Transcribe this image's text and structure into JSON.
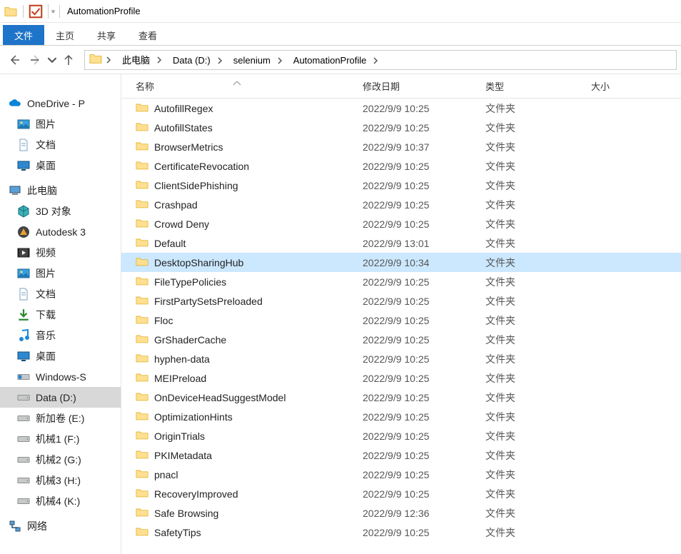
{
  "window": {
    "title": "AutomationProfile"
  },
  "ribbon": {
    "file": "文件",
    "tabs": [
      "主页",
      "共享",
      "查看"
    ]
  },
  "breadcrumb": {
    "items": [
      "此电脑",
      "Data (D:)",
      "selenium",
      "AutomationProfile"
    ]
  },
  "tree": {
    "groups": [
      {
        "root": {
          "label": "OneDrive - P",
          "icon": "onedrive"
        },
        "children": [
          {
            "label": "图片",
            "icon": "pictures"
          },
          {
            "label": "文档",
            "icon": "documents"
          },
          {
            "label": "桌面",
            "icon": "desktop"
          }
        ]
      },
      {
        "root": {
          "label": "此电脑",
          "icon": "thispc"
        },
        "children": [
          {
            "label": "3D 对象",
            "icon": "3d"
          },
          {
            "label": "Autodesk 3",
            "icon": "autodesk"
          },
          {
            "label": "视频",
            "icon": "videos"
          },
          {
            "label": "图片",
            "icon": "pictures"
          },
          {
            "label": "文档",
            "icon": "documents"
          },
          {
            "label": "下载",
            "icon": "downloads"
          },
          {
            "label": "音乐",
            "icon": "music"
          },
          {
            "label": "桌面",
            "icon": "desktop"
          },
          {
            "label": "Windows-S",
            "icon": "drive-os"
          },
          {
            "label": "Data (D:)",
            "icon": "drive",
            "selected": true
          },
          {
            "label": "新加卷 (E:)",
            "icon": "drive"
          },
          {
            "label": "机械1 (F:)",
            "icon": "drive"
          },
          {
            "label": "机械2 (G:)",
            "icon": "drive"
          },
          {
            "label": "机械3 (H:)",
            "icon": "drive"
          },
          {
            "label": "机械4 (K:)",
            "icon": "drive"
          }
        ]
      },
      {
        "root": {
          "label": "网络",
          "icon": "network"
        },
        "children": []
      }
    ]
  },
  "columns": {
    "name": "名称",
    "date": "修改日期",
    "type": "类型",
    "size": "大小"
  },
  "type_label": "文件夹",
  "rows": [
    {
      "name": "AutofillRegex",
      "date": "2022/9/9 10:25"
    },
    {
      "name": "AutofillStates",
      "date": "2022/9/9 10:25"
    },
    {
      "name": "BrowserMetrics",
      "date": "2022/9/9 10:37"
    },
    {
      "name": "CertificateRevocation",
      "date": "2022/9/9 10:25"
    },
    {
      "name": "ClientSidePhishing",
      "date": "2022/9/9 10:25"
    },
    {
      "name": "Crashpad",
      "date": "2022/9/9 10:25"
    },
    {
      "name": "Crowd Deny",
      "date": "2022/9/9 10:25"
    },
    {
      "name": "Default",
      "date": "2022/9/9 13:01"
    },
    {
      "name": "DesktopSharingHub",
      "date": "2022/9/9 10:34",
      "selected": true
    },
    {
      "name": "FileTypePolicies",
      "date": "2022/9/9 10:25"
    },
    {
      "name": "FirstPartySetsPreloaded",
      "date": "2022/9/9 10:25"
    },
    {
      "name": "Floc",
      "date": "2022/9/9 10:25"
    },
    {
      "name": "GrShaderCache",
      "date": "2022/9/9 10:25"
    },
    {
      "name": "hyphen-data",
      "date": "2022/9/9 10:25"
    },
    {
      "name": "MEIPreload",
      "date": "2022/9/9 10:25"
    },
    {
      "name": "OnDeviceHeadSuggestModel",
      "date": "2022/9/9 10:25"
    },
    {
      "name": "OptimizationHints",
      "date": "2022/9/9 10:25"
    },
    {
      "name": "OriginTrials",
      "date": "2022/9/9 10:25"
    },
    {
      "name": "PKIMetadata",
      "date": "2022/9/9 10:25"
    },
    {
      "name": "pnacl",
      "date": "2022/9/9 10:25"
    },
    {
      "name": "RecoveryImproved",
      "date": "2022/9/9 10:25"
    },
    {
      "name": "Safe Browsing",
      "date": "2022/9/9 12:36"
    },
    {
      "name": "SafetyTips",
      "date": "2022/9/9 10:25"
    }
  ]
}
